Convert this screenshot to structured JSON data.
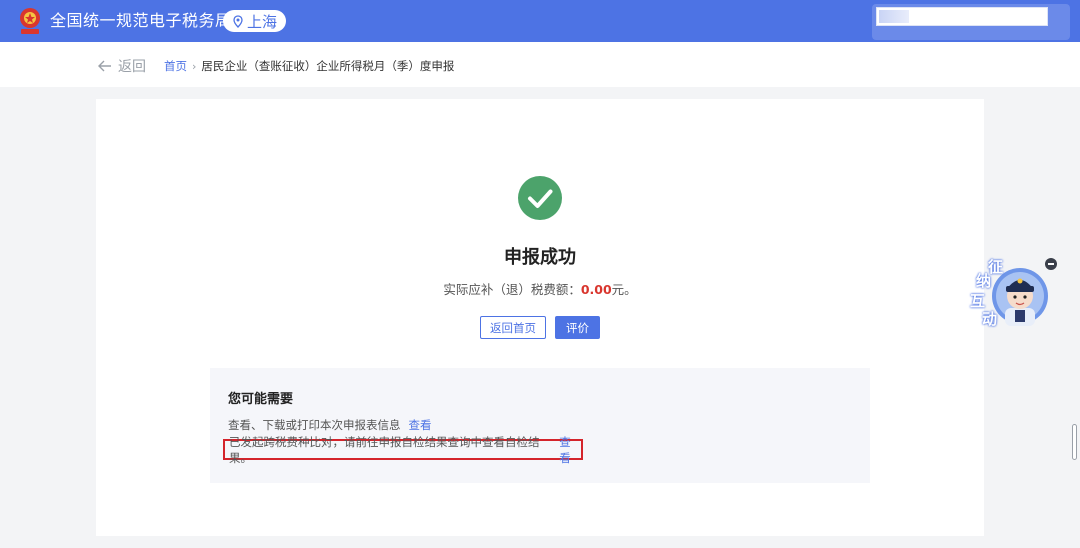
{
  "header": {
    "site_title": "全国统一规范电子税务局",
    "region": "上海",
    "emblem_icon": "tax-emblem-icon",
    "region_icon": "location-pin-icon"
  },
  "breadcrumb": {
    "back_label": "返回",
    "back_icon": "arrow-left-icon",
    "home": "首页",
    "separator": "›",
    "current": "居民企业（查账征收）企业所得税月（季）度申报"
  },
  "result": {
    "icon": "check-circle-icon",
    "title": "申报成功",
    "tax_label": "实际应补（退）税费额：",
    "tax_amount": "0.00",
    "tax_unit": "元。",
    "buttons": {
      "home": "返回首页",
      "rate": "评价"
    }
  },
  "suggestions": {
    "title": "您可能需要",
    "row1_text": "查看、下载或打印本次申报表信息",
    "row1_link": "查看",
    "row2_text": "已发起跨税费种比对，请前往申报自检结果查询中查看自检结果。",
    "row2_link": "查看"
  },
  "assistant": {
    "chars": [
      "征",
      "纳",
      "互",
      "动"
    ],
    "icon": "tax-officer-avatar-icon",
    "close_icon": "minimize-icon"
  },
  "colors": {
    "primary": "#4d73e4",
    "success": "#4ca36b",
    "amount": "#d9362e",
    "highlight_border": "#d4242b"
  }
}
